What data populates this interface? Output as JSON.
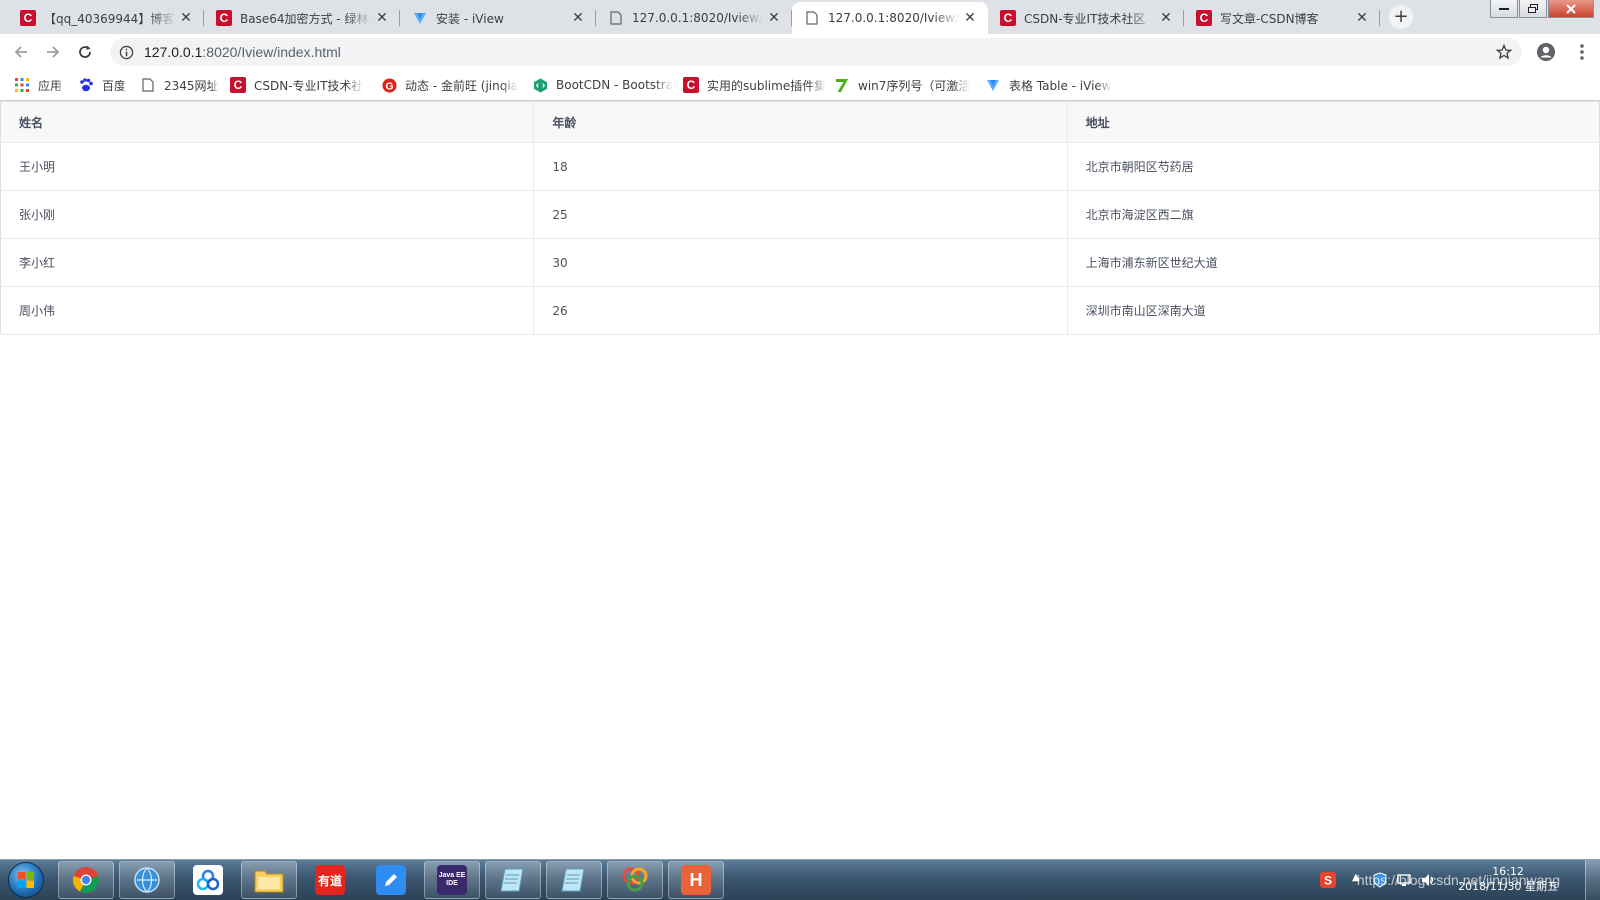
{
  "tabs": [
    {
      "title": "【qq_40369944】博客 - ",
      "icon": "csdn-icon",
      "active": false
    },
    {
      "title": "Base64加密方式 - 绿林看",
      "icon": "csdn-icon",
      "active": false
    },
    {
      "title": "安装 - iView",
      "icon": "iview-icon",
      "active": false
    },
    {
      "title": "127.0.0.1:8020/Iview/in",
      "icon": "page-icon",
      "active": false
    },
    {
      "title": "127.0.0.1:8020/Iview/in",
      "icon": "page-icon",
      "active": true
    },
    {
      "title": "CSDN-专业IT技术社区",
      "icon": "csdn-icon",
      "active": false
    },
    {
      "title": "写文章-CSDN博客",
      "icon": "csdn-icon",
      "active": false
    }
  ],
  "address_bar": {
    "host": "127.0.0.1",
    "path": ":8020/Iview/index.html"
  },
  "bookmarks": [
    {
      "label": "应用",
      "icon": "apps-grid-icon"
    },
    {
      "label": "百度",
      "icon": "baidu-paw-icon"
    },
    {
      "label": "2345网址",
      "icon": "page-icon"
    },
    {
      "label": "CSDN-专业IT技术社",
      "icon": "csdn-icon"
    },
    {
      "label": "动态 - 金前旺 (jinqia",
      "icon": "jinqianwang-icon"
    },
    {
      "label": "BootCDN - Bootstra",
      "icon": "bootcdn-icon"
    },
    {
      "label": "实用的sublime插件集",
      "icon": "csdn-icon"
    },
    {
      "label": "win7序列号（可激活",
      "icon": "green-seven-icon"
    },
    {
      "label": "表格 Table - iView",
      "icon": "iview-icon"
    }
  ],
  "table": {
    "columns": [
      "姓名",
      "年龄",
      "地址"
    ],
    "rows": [
      {
        "name": "王小明",
        "age": "18",
        "address": "北京市朝阳区芍药居"
      },
      {
        "name": "张小刚",
        "age": "25",
        "address": "北京市海淀区西二旗"
      },
      {
        "name": "李小红",
        "age": "30",
        "address": "上海市浦东新区世纪大道"
      },
      {
        "name": "周小伟",
        "age": "26",
        "address": "深圳市南山区深南大道"
      }
    ]
  },
  "taskbar": {
    "apps": [
      "chrome-icon",
      "ie-globe-icon",
      "baidu-netdisk-icon",
      "file-explorer-icon",
      "youdao-icon",
      "pen-icon",
      "java-ee-ide-icon",
      "notepad-icon",
      "notepad-icon",
      "color-app-icon",
      "hbuilder-icon"
    ],
    "youdao_label": "有道",
    "java_label": "Java EE IDE",
    "hbuilder_label": "H",
    "time": "16:12",
    "date": "2018/11/30 星期五",
    "watermark": "https://blog.csdn.net/jinqianwang"
  },
  "colors": {
    "accent_blue": "#2d8cf0",
    "csdn_red": "#c8102e",
    "table_border": "#e9eaec",
    "table_header_bg": "#f8f8f9",
    "table_text": "#495060"
  }
}
